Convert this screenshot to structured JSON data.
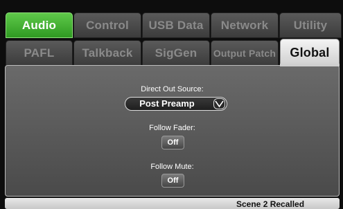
{
  "tabs_row1": [
    "Audio",
    "Control",
    "USB Data",
    "Network",
    "Utility"
  ],
  "tabs_row2": [
    "PAFL",
    "Talkback",
    "SigGen",
    "Output Patch",
    "Global"
  ],
  "active_row1": "Audio",
  "active_row2": "Global",
  "global": {
    "direct_out_label": "Direct Out Source:",
    "direct_out_value": "Post Preamp",
    "follow_fader_label": "Follow Fader:",
    "follow_fader_value": "Off",
    "follow_mute_label": "Follow Mute:",
    "follow_mute_value": "Off"
  },
  "status": {
    "text": "Scene 2 Recalled"
  },
  "colors": {
    "active_tab": "#3fae2e",
    "selected_tab": "#e6e6e6",
    "panel": "#5c5c5c"
  }
}
